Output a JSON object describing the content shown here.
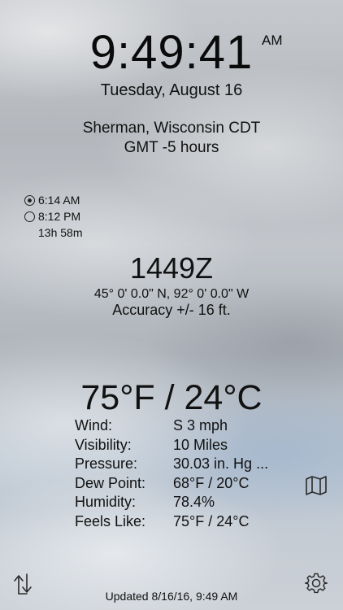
{
  "clock": {
    "time": "9:49:41",
    "meridiem": "AM",
    "date": "Tuesday, August 16"
  },
  "location": {
    "place": "Sherman, Wisconsin CDT",
    "gmt_offset": "GMT -5 hours"
  },
  "sun": {
    "sunrise": "6:14 AM",
    "sunset": "8:12 PM",
    "day_length": "13h 58m"
  },
  "position": {
    "grid": "1449Z",
    "coordinates": "45° 0' 0.0\" N, 92° 0' 0.0\" W",
    "accuracy": "Accuracy +/- 16 ft."
  },
  "weather": {
    "temperature": "75°F / 24°C",
    "rows": [
      {
        "label": "Wind:",
        "value": "S 3 mph"
      },
      {
        "label": "Visibility:",
        "value": "10 Miles"
      },
      {
        "label": "Pressure:",
        "value": "30.03 in. Hg ..."
      },
      {
        "label": "Dew Point:",
        "value": "68°F / 20°C"
      },
      {
        "label": "Humidity:",
        "value": "78.4%"
      },
      {
        "label": "Feels Like:",
        "value": "75°F / 24°C"
      }
    ]
  },
  "footer": {
    "updated": "Updated 8/16/16, 9:49 AM"
  },
  "icons": {
    "map": "map-icon",
    "swap": "swap-icon",
    "settings": "gear-icon",
    "sunrise": "sunrise-icon",
    "sunset": "sunset-icon"
  }
}
